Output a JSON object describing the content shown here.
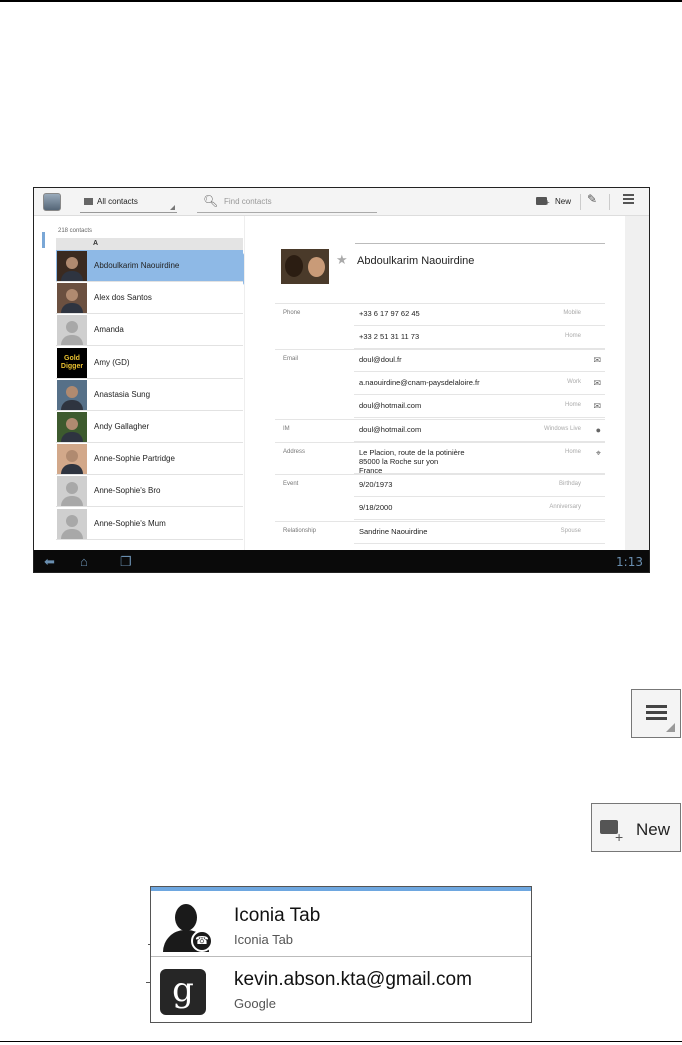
{
  "actionbar": {
    "filter_label": "All contacts",
    "search_placeholder": "Find contacts",
    "new_label": "New"
  },
  "list": {
    "count": "218 contacts",
    "section_letter": "A",
    "contacts": [
      {
        "name": "Abdoulkarim Naouirdine",
        "selected": true,
        "photo": "photo"
      },
      {
        "name": "Alex dos Santos",
        "selected": false,
        "photo": "photo"
      },
      {
        "name": "Amanda",
        "selected": false,
        "photo": "placeholder"
      },
      {
        "name": "Amy (GD)",
        "selected": false,
        "photo": "gold-digger"
      },
      {
        "name": "Anastasia Sung",
        "selected": false,
        "photo": "photo"
      },
      {
        "name": "Andy Gallagher",
        "selected": false,
        "photo": "photo"
      },
      {
        "name": "Anne-Sophie Partridge",
        "selected": false,
        "photo": "photo"
      },
      {
        "name": "Anne-Sophie's Bro",
        "selected": false,
        "photo": "placeholder"
      },
      {
        "name": "Anne-Sophie's Mum",
        "selected": false,
        "photo": "placeholder"
      }
    ],
    "gold_digger_text": "Gold\nDigger"
  },
  "detail": {
    "name": "Abdoulkarim Naouirdine",
    "rows": [
      {
        "label": "Phone",
        "value": "+33 6 17 97 62 45",
        "type": "Mobile",
        "icon": ""
      },
      {
        "label": "",
        "value": "+33 2 51 31 11 73",
        "type": "Home",
        "icon": ""
      },
      {
        "label": "Email",
        "value": "doul@doul.fr",
        "type": "",
        "icon": "email-icon"
      },
      {
        "label": "",
        "value": "a.naouirdine@cnam-paysdelaloire.fr",
        "type": "Work",
        "icon": "email-icon"
      },
      {
        "label": "",
        "value": "doul@hotmail.com",
        "type": "Home",
        "icon": "email-icon"
      },
      {
        "label": "IM",
        "value": "doul@hotmail.com",
        "type": "Windows Live",
        "icon": "chat-icon"
      },
      {
        "label": "Address",
        "value": "Le Placion, route de la potinière\n85000 la Roche sur yon\nFrance",
        "type": "Home",
        "icon": "map-pin-icon"
      },
      {
        "label": "Event",
        "value": "9/20/1973",
        "type": "Birthday",
        "icon": ""
      },
      {
        "label": "",
        "value": "9/18/2000",
        "type": "Anniversary",
        "icon": ""
      },
      {
        "label": "Relationship",
        "value": "Sandrine Naouirdine",
        "type": "Spouse",
        "icon": ""
      }
    ]
  },
  "statusbar": {
    "clock": "1:13"
  },
  "buttons": {
    "new_label": "New"
  },
  "accounts": [
    {
      "title": "Iconia Tab",
      "subtitle": "Iconia Tab",
      "icon": "phone-contact-icon"
    },
    {
      "title": "kevin.abson.kta@gmail.com",
      "subtitle": "Google",
      "icon": "google-icon"
    }
  ]
}
